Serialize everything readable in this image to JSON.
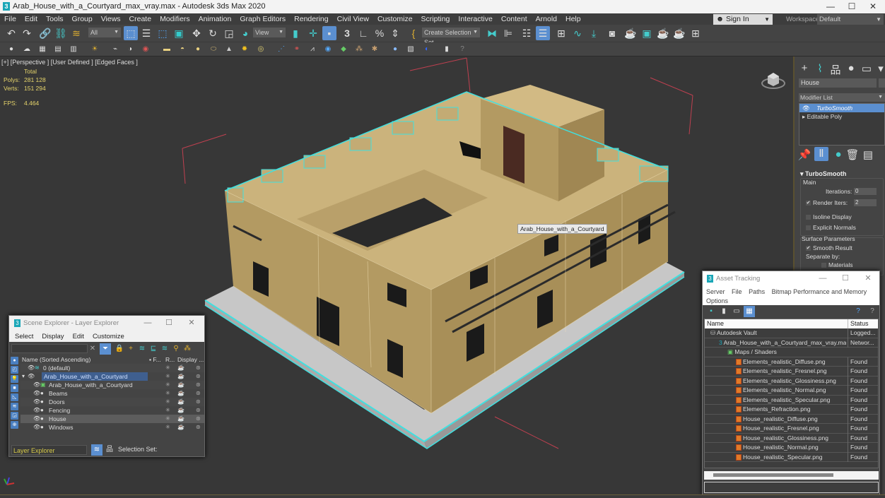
{
  "app": {
    "title": "Arab_House_with_a_Courtyard_max_vray.max - Autodesk 3ds Max 2020",
    "logo_glyph": "3"
  },
  "window_controls": {
    "minimize": "—",
    "maximize": "☐",
    "close": "✕"
  },
  "menu": [
    "File",
    "Edit",
    "Tools",
    "Group",
    "Views",
    "Create",
    "Modifiers",
    "Animation",
    "Graph Editors",
    "Rendering",
    "Civil View",
    "Customize",
    "Scripting",
    "Interactive",
    "Content",
    "Arnold",
    "Help"
  ],
  "account": {
    "sign_in": "Sign In",
    "workspaces_label": "Workspaces:",
    "workspace": "Default"
  },
  "toolbar": {
    "selection_filter": "All",
    "ref_coord": "View",
    "selection_set_placeholder": "Create Selection Set",
    "snap_label": "3",
    "percent_snap": "%"
  },
  "viewport": {
    "label": "[+] [Perspective ] [User Defined ] [Edged Faces ]",
    "stats": {
      "header": "Total",
      "polys_label": "Polys:",
      "polys": "281 128",
      "verts_label": "Verts:",
      "verts": "151 294",
      "fps_label": "FPS:",
      "fps": "4.464"
    },
    "object_tooltip": "Arab_House_with_a_Courtyard",
    "colors": {
      "background": "#373737",
      "selection_outline": "#3fe0e0",
      "wall": "#b8a068",
      "roof": "#cdb57e",
      "base": "#c9c9c9"
    }
  },
  "command_panel": {
    "object_name": "House",
    "modifier_list": "Modifier List",
    "stack": [
      {
        "label": "TurboSmooth",
        "selected": true
      },
      {
        "label": "Editable Poly",
        "selected": false
      }
    ],
    "rollout": {
      "title": "TurboSmooth",
      "main_group": "Main",
      "iterations_label": "Iterations:",
      "iterations": "0",
      "render_iters_label": "Render Iters:",
      "render_iters": "2",
      "render_iters_checked": true,
      "isoline_display": "Isoline Display",
      "isoline_checked": false,
      "explicit_normals": "Explicit Normals",
      "explicit_checked": false,
      "surface_group": "Surface Parameters",
      "smooth_result": "Smooth Result",
      "smooth_checked": true,
      "separate_by": "Separate by:",
      "materials": "Materials",
      "materials_checked": false
    }
  },
  "scene_explorer": {
    "title": "Scene Explorer - Layer Explorer",
    "menu": [
      "Select",
      "Display",
      "Edit",
      "Customize"
    ],
    "columns": {
      "name": "Name (Sorted Ascending)",
      "frozen": "▪ F...",
      "render": "R...",
      "display": "Display ..."
    },
    "rows": [
      {
        "name": "0 (default)",
        "level": 0,
        "kind": "layer"
      },
      {
        "name": "Arab_House_with_a_Courtyard",
        "level": 0,
        "kind": "layer-active",
        "expanded": true
      },
      {
        "name": "Arab_House_with_a_Courtyard",
        "level": 1,
        "kind": "group"
      },
      {
        "name": "Beams",
        "level": 1,
        "kind": "object"
      },
      {
        "name": "Doors",
        "level": 1,
        "kind": "object"
      },
      {
        "name": "Fencing",
        "level": 1,
        "kind": "object"
      },
      {
        "name": "House",
        "level": 1,
        "kind": "object",
        "selected": true
      },
      {
        "name": "Windows",
        "level": 1,
        "kind": "object"
      }
    ],
    "mode": "Layer Explorer",
    "selection_set_label": "Selection Set:"
  },
  "asset_tracking": {
    "title": "Asset Tracking",
    "menu": [
      "Server",
      "File",
      "Paths",
      "Bitmap Performance and Memory",
      "Options"
    ],
    "columns": {
      "name": "Name",
      "status": "Status"
    },
    "rows": [
      {
        "name": "Autodesk Vault",
        "status": "Logged...",
        "level": 0,
        "icon": "vault"
      },
      {
        "name": "Arab_House_with_a_Courtyard_max_vray.max",
        "status": "Networ...",
        "level": 1,
        "icon": "max"
      },
      {
        "name": "Maps / Shaders",
        "status": "",
        "level": 2,
        "icon": "folder"
      },
      {
        "name": "Elements_realistic_Diffuse.png",
        "status": "Found",
        "level": 3,
        "icon": "image"
      },
      {
        "name": "Elements_realistic_Fresnel.png",
        "status": "Found",
        "level": 3,
        "icon": "image"
      },
      {
        "name": "Elements_realistic_Glossiness.png",
        "status": "Found",
        "level": 3,
        "icon": "image"
      },
      {
        "name": "Elements_realistic_Normal.png",
        "status": "Found",
        "level": 3,
        "icon": "image"
      },
      {
        "name": "Elements_realistic_Specular.png",
        "status": "Found",
        "level": 3,
        "icon": "image"
      },
      {
        "name": "Elements_Refraction.png",
        "status": "Found",
        "level": 3,
        "icon": "image"
      },
      {
        "name": "House_realistic_Diffuse.png",
        "status": "Found",
        "level": 3,
        "icon": "image"
      },
      {
        "name": "House_realistic_Fresnel.png",
        "status": "Found",
        "level": 3,
        "icon": "image"
      },
      {
        "name": "House_realistic_Glossiness.png",
        "status": "Found",
        "level": 3,
        "icon": "image"
      },
      {
        "name": "House_realistic_Normal.png",
        "status": "Found",
        "level": 3,
        "icon": "image"
      },
      {
        "name": "House_realistic_Specular.png",
        "status": "Found",
        "level": 3,
        "icon": "image"
      }
    ]
  }
}
